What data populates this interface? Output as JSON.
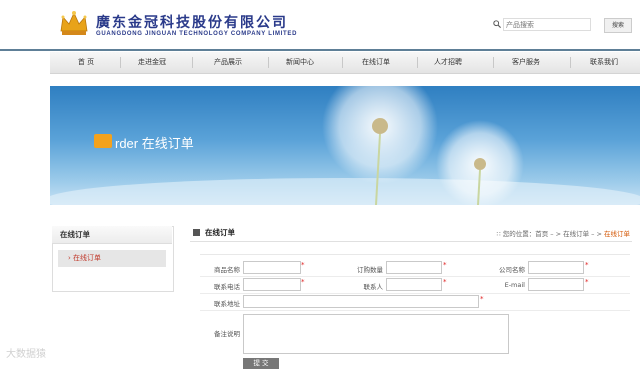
{
  "header": {
    "company_cn": "廣东金冠科技股份有限公司",
    "company_en": "GUANGDONG JINGUAN TECHNOLOGY COMPANY LIMITED",
    "search_placeholder": "产品搜索",
    "search_button": "搜索",
    "logo_icon": "crown-logo-icon",
    "brand_color": "#2a3a8a"
  },
  "nav": {
    "items": [
      {
        "label": "首  页"
      },
      {
        "label": "走进金冠"
      },
      {
        "label": "产品展示"
      },
      {
        "label": "新闻中心"
      },
      {
        "label": "在线订单"
      },
      {
        "label": "人才招聘"
      },
      {
        "label": "客户服务"
      },
      {
        "label": "联系我们"
      }
    ]
  },
  "banner": {
    "title": "rder  在线订单",
    "o_letter": "O"
  },
  "sidebar": {
    "title": "在线订单",
    "items": [
      {
        "label": "› 在线订单"
      }
    ]
  },
  "content": {
    "title": "在线订单",
    "breadcrumb_prefix": "∷ 您的位置：首页 – > 在线订单 – > ",
    "breadcrumb_current": "在线订单"
  },
  "form": {
    "product_name_label": "商品名称",
    "order_qty_label": "订购数量",
    "company_name_label": "公司名称",
    "phone_label": "联系电话",
    "contact_label": "联系人",
    "email_label": "E-mail",
    "address_label": "联系地址",
    "remarks_label": "备注说明",
    "required_mark": "*",
    "submit_label": "提 交"
  },
  "watermark": "大数据猿"
}
